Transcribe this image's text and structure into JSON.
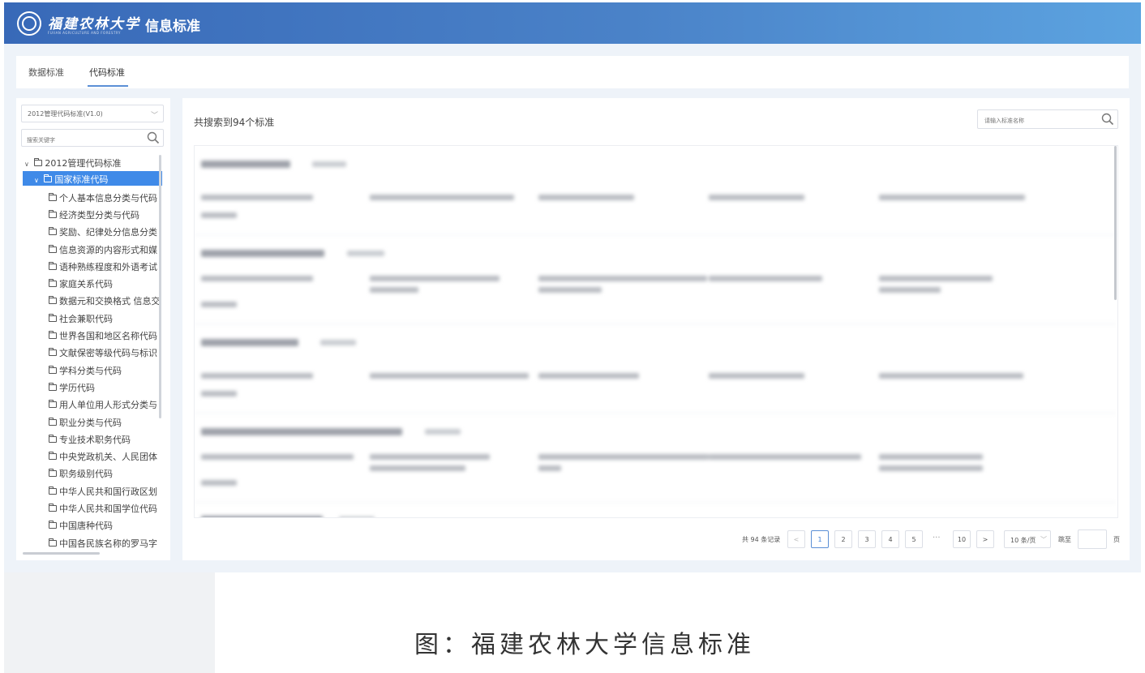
{
  "header": {
    "school_name": "福建农林大学",
    "school_name_en": "FUJIAN AGRICULTURE AND FORESTRY UNIVERSITY",
    "app_title": "信息标准"
  },
  "tabs": [
    {
      "label": "数据标准",
      "active": false
    },
    {
      "label": "代码标准",
      "active": true
    }
  ],
  "sidebar": {
    "version_select": "2012管理代码标准(V1.0)",
    "search_placeholder": "搜索关键字",
    "tree_root": "2012管理代码标准",
    "tree_selected": "国家标准代码",
    "tree_items": [
      "个人基本信息分类与代码",
      "经济类型分类与代码",
      "奖励、纪律处分信息分类",
      "信息资源的内容形式和媒",
      "语种熟练程度和外语考试",
      "家庭关系代码",
      "数据元和交换格式 信息交",
      "社会兼职代码",
      "世界各国和地区名称代码",
      "文献保密等级代码与标识",
      "学科分类与代码",
      "学历代码",
      "用人单位用人形式分类与",
      "职业分类与代码",
      "专业技术职务代码",
      "中央党政机关、人民团体",
      "职务级别代码",
      "中华人民共和国行政区划",
      "中华人民共和国学位代码",
      "中国唐种代码",
      "中国各民族名称的罗马字"
    ]
  },
  "main": {
    "result_count": "共搜索到94个标准",
    "search_placeholder": "请输入标准名称"
  },
  "pagination": {
    "total": "共 94 条记录",
    "prev": "<",
    "pages": [
      "1",
      "2",
      "3",
      "4",
      "5"
    ],
    "ellipsis": "···",
    "last_page": "10",
    "next": ">",
    "page_size": "10 条/页",
    "jump_label": "跳至",
    "page_label": "页",
    "current": 1
  },
  "caption": "图：福建农林大学信息标准",
  "colors": {
    "header_start": "#3869b8",
    "header_end": "#5ca3e0",
    "accent": "#3f8ae8"
  }
}
